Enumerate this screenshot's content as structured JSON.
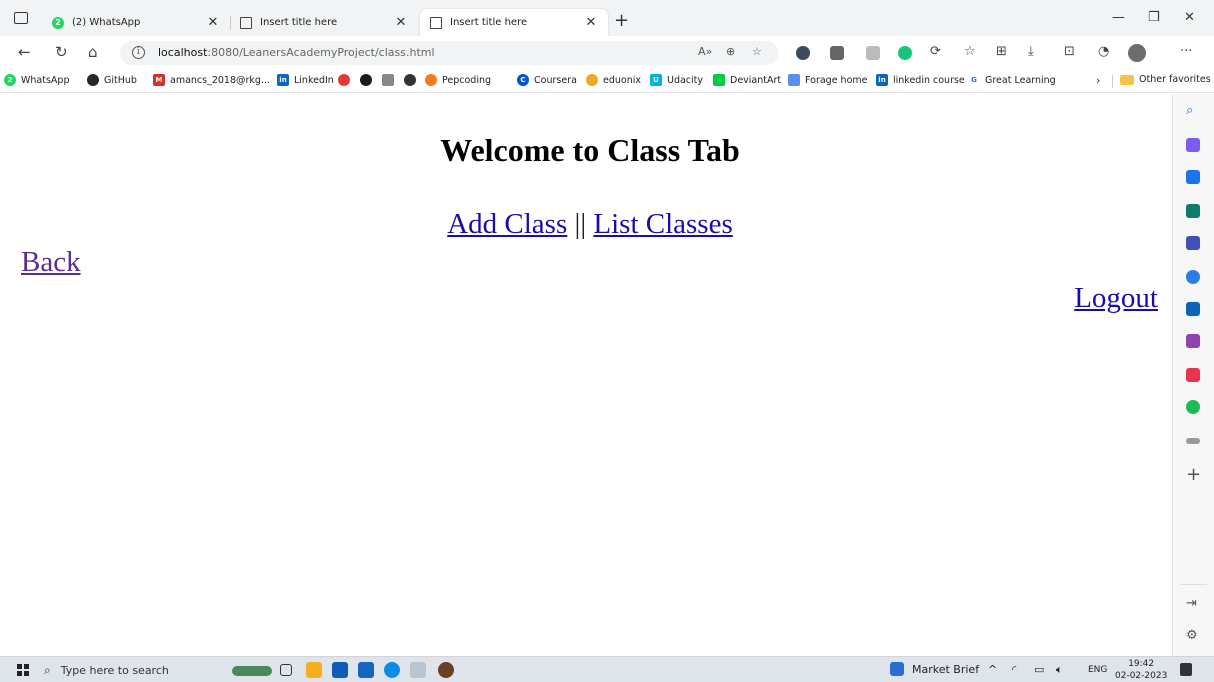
{
  "browser": {
    "tabs": [
      {
        "title": "(2) WhatsApp",
        "icon": "whatsapp-icon",
        "active": false
      },
      {
        "title": "Insert title here",
        "icon": "page-icon",
        "active": false
      },
      {
        "title": "Insert title here",
        "icon": "page-icon",
        "active": true
      }
    ],
    "url": {
      "host": "localhost",
      "rest": ":8080/LeanersAcademyProject/class.html"
    },
    "bookmarks": [
      {
        "label": "WhatsApp",
        "color": "#25d366"
      },
      {
        "label": "GitHub",
        "color": "#24292e"
      },
      {
        "label": "amancs_2018@rkg...",
        "color": "#d93025"
      },
      {
        "label": "LinkedIn",
        "color": "#0a66c2"
      },
      {
        "label": "Pepcoding",
        "color": "#f47b20"
      },
      {
        "label": "Coursera",
        "color": "#0056d2"
      },
      {
        "label": "eduonix",
        "color": "#f5a623"
      },
      {
        "label": "Udacity",
        "color": "#02b3e4"
      },
      {
        "label": "DeviantArt",
        "color": "#05cc47"
      },
      {
        "label": "Forage home",
        "color": "#5b8def"
      },
      {
        "label": "linkedin course",
        "color": "#0a66c2"
      },
      {
        "label": "Great Learning",
        "color": "#1a73e8"
      }
    ],
    "other_favorites": "Other favorites"
  },
  "page": {
    "heading": "Welcome to Class Tab",
    "add_class": "Add Class",
    "separator": "||",
    "list_classes": "List Classes",
    "back": "Back",
    "logout": "Logout"
  },
  "taskbar": {
    "search_placeholder": "Type here to search",
    "market_brief": "Market Brief",
    "language": "ENG",
    "time": "19:42",
    "date": "02-02-2023"
  }
}
